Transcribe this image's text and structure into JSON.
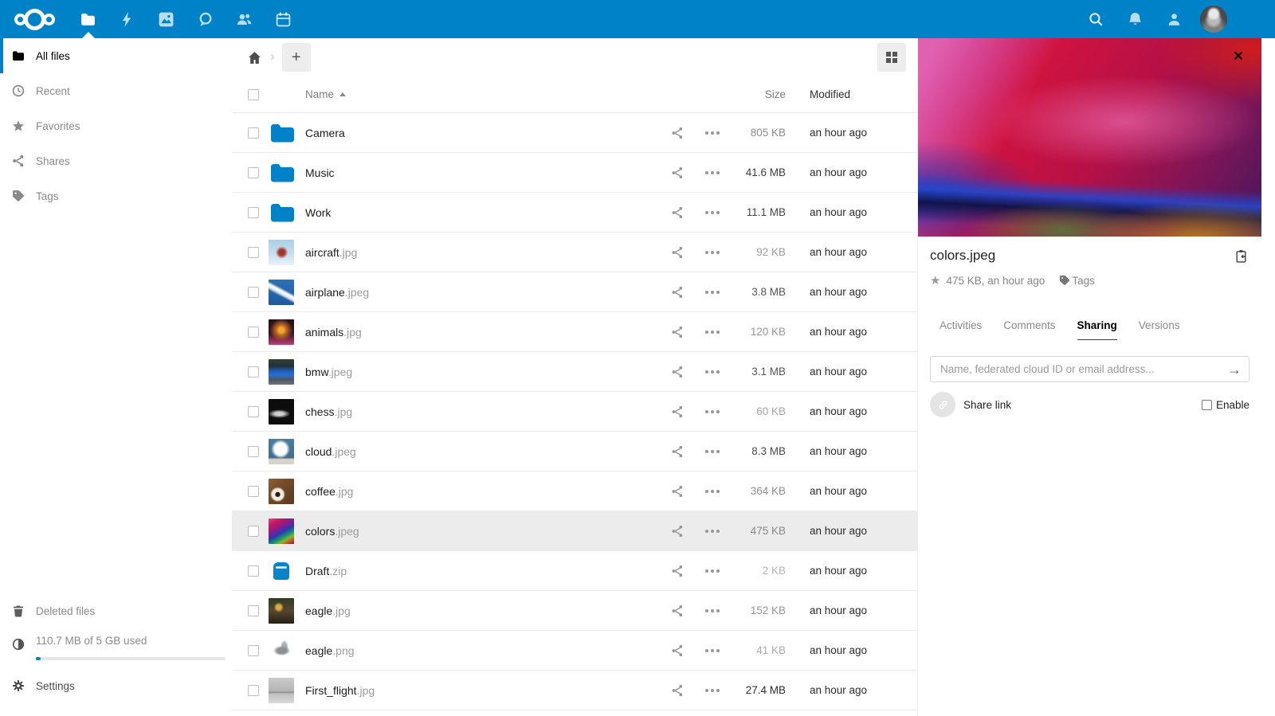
{
  "topbar": {
    "app_icons": [
      "files-folder-icon",
      "activity-lightning-icon",
      "gallery-icon",
      "talk-bubble-icon",
      "contacts-icon",
      "calendar-icon"
    ],
    "active_app": "files",
    "right_icons": [
      "search-icon",
      "notifications-bell-icon",
      "contacts-menu-icon",
      "user-avatar"
    ]
  },
  "sidebar": {
    "items": [
      {
        "label": "All files",
        "icon": "folder-icon",
        "active": true
      },
      {
        "label": "Recent",
        "icon": "clock-icon",
        "active": false
      },
      {
        "label": "Favorites",
        "icon": "star-icon",
        "active": false
      },
      {
        "label": "Shares",
        "icon": "share-icon",
        "active": false
      },
      {
        "label": "Tags",
        "icon": "tag-icon",
        "active": false
      }
    ],
    "deleted_label": "Deleted files",
    "quota_text": "110.7 MB of 5 GB used",
    "quota_percent": 2,
    "settings_label": "Settings"
  },
  "filelist": {
    "headers": {
      "name": "Name",
      "size": "Size",
      "modified": "Modified"
    },
    "sort": "name-ascending",
    "files": [
      {
        "name": "Camera",
        "ext": "",
        "type": "folder",
        "thumb": "folder",
        "size": "805 KB",
        "size_color": "#8d8d8d",
        "modified": "an hour ago",
        "selected": false
      },
      {
        "name": "Music",
        "ext": "",
        "type": "folder",
        "thumb": "folder",
        "size": "41.6 MB",
        "size_color": "#3f3f3f",
        "modified": "an hour ago",
        "selected": false
      },
      {
        "name": "Work",
        "ext": "",
        "type": "folder",
        "thumb": "folder",
        "size": "11.1 MB",
        "size_color": "#464646",
        "modified": "an hour ago",
        "selected": false
      },
      {
        "name": "aircraft",
        "ext": ".jpg",
        "type": "image",
        "thumb": "aircraft",
        "size": "92 KB",
        "size_color": "#9d9d9d",
        "modified": "an hour ago",
        "selected": false
      },
      {
        "name": "airplane",
        "ext": ".jpeg",
        "type": "image",
        "thumb": "airplane",
        "size": "3.8 MB",
        "size_color": "#555555",
        "modified": "an hour ago",
        "selected": false
      },
      {
        "name": "animals",
        "ext": ".jpg",
        "type": "image",
        "thumb": "animals",
        "size": "120 KB",
        "size_color": "#989898",
        "modified": "an hour ago",
        "selected": false
      },
      {
        "name": "bmw",
        "ext": ".jpeg",
        "type": "image",
        "thumb": "bmw",
        "size": "3.1 MB",
        "size_color": "#575757",
        "modified": "an hour ago",
        "selected": false
      },
      {
        "name": "chess",
        "ext": ".jpg",
        "type": "image",
        "thumb": "chess",
        "size": "60 KB",
        "size_color": "#a3a3a3",
        "modified": "an hour ago",
        "selected": false
      },
      {
        "name": "cloud",
        "ext": ".jpeg",
        "type": "image",
        "thumb": "cloud",
        "size": "8.3 MB",
        "size_color": "#4a4a4a",
        "modified": "an hour ago",
        "selected": false
      },
      {
        "name": "coffee",
        "ext": ".jpg",
        "type": "image",
        "thumb": "coffee",
        "size": "364 KB",
        "size_color": "#8d8d8d",
        "modified": "an hour ago",
        "selected": false
      },
      {
        "name": "colors",
        "ext": ".jpeg",
        "type": "image",
        "thumb": "colors",
        "size": "475 KB",
        "size_color": "#888888",
        "modified": "an hour ago",
        "selected": true
      },
      {
        "name": "Draft",
        "ext": ".zip",
        "type": "archive",
        "thumb": "zip",
        "size": "2 KB",
        "size_color": "#b5b5b5",
        "modified": "an hour ago",
        "selected": false
      },
      {
        "name": "eagle",
        "ext": ".jpg",
        "type": "image",
        "thumb": "eagle-jpg",
        "size": "152 KB",
        "size_color": "#969696",
        "modified": "an hour ago",
        "selected": false
      },
      {
        "name": "eagle",
        "ext": ".png",
        "type": "image",
        "thumb": "eagle-png",
        "size": "41 KB",
        "size_color": "#ababab",
        "modified": "an hour ago",
        "selected": false
      },
      {
        "name": "First_flight",
        "ext": ".jpg",
        "type": "image",
        "thumb": "first-flight",
        "size": "27.4 MB",
        "size_color": "#2e2e2e",
        "modified": "an hour ago",
        "selected": false
      }
    ]
  },
  "panel": {
    "filename": "colors.jpeg",
    "meta": "475 KB, an hour ago",
    "tags_label": "Tags",
    "tabs": [
      "Activities",
      "Comments",
      "Sharing",
      "Versions"
    ],
    "active_tab": "Sharing",
    "share_placeholder": "Name, federated cloud ID or email address...",
    "share_link_label": "Share link",
    "enable_label": "Enable"
  },
  "colors": {
    "brand": "#0082c9",
    "selected_row": "#ececec"
  }
}
